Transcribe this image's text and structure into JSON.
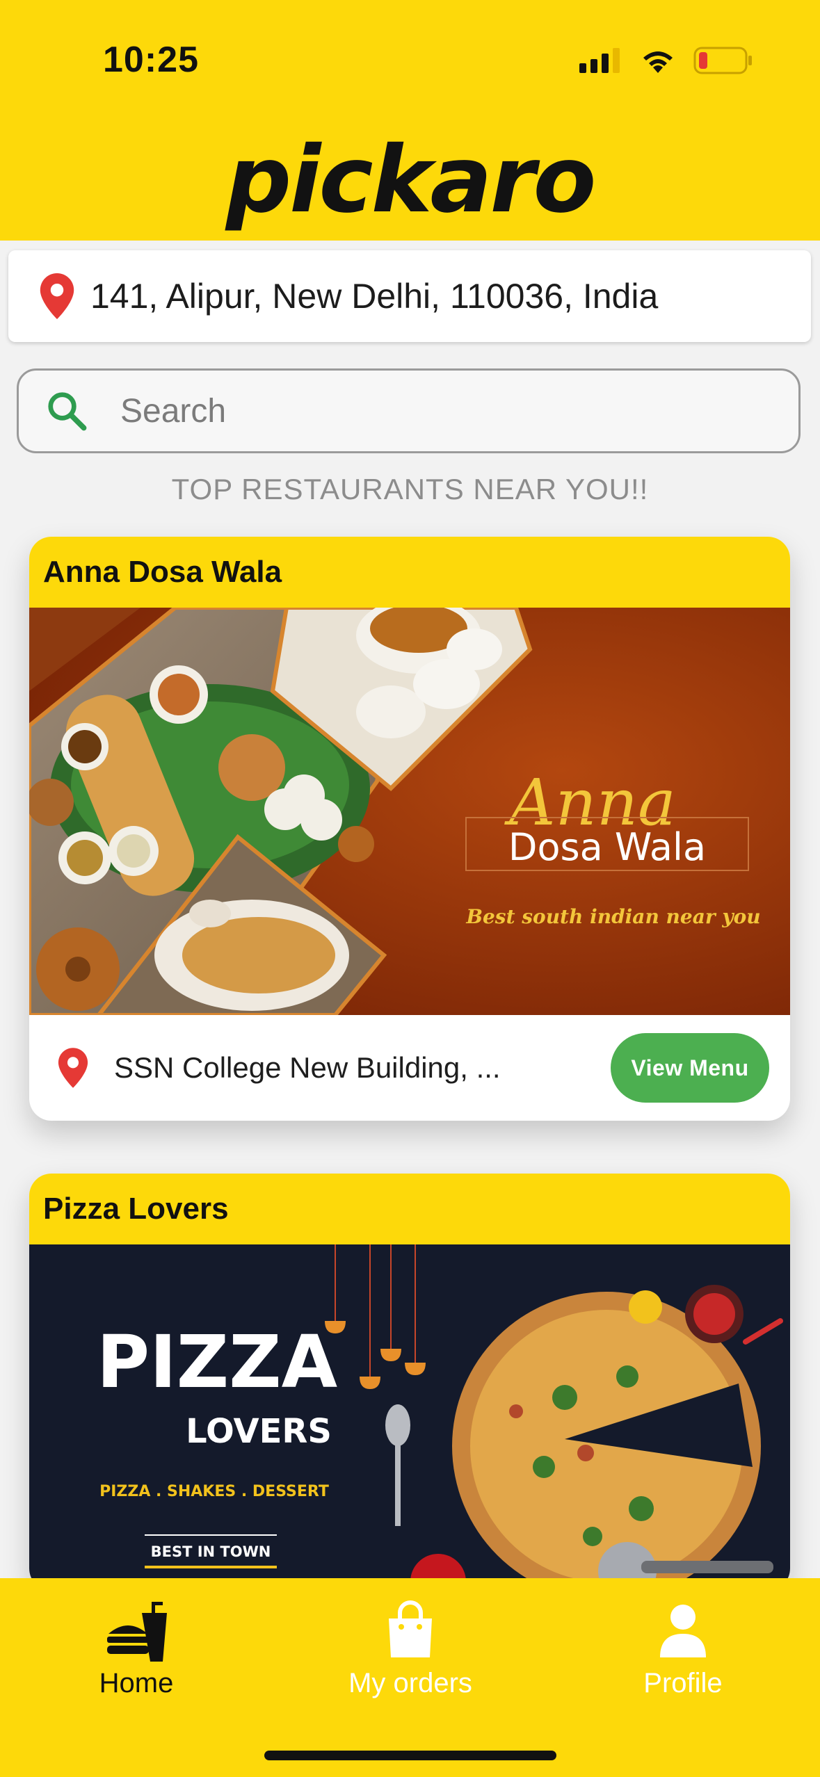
{
  "status_bar": {
    "time": "10:25"
  },
  "app": {
    "logo_text": "pickaro"
  },
  "address_bar": {
    "address": "141, Alipur, New Delhi, 110036, India"
  },
  "search": {
    "placeholder": "Search"
  },
  "section": {
    "title": "TOP RESTAURANTS NEAR YOU!!"
  },
  "restaurants": [
    {
      "name": "Anna Dosa Wala",
      "banner": {
        "title_script": "Anna",
        "title": "Dosa Wala",
        "tagline": "Best south indian near you"
      },
      "address": "SSN College New Building, ...",
      "button_label": "View Menu"
    },
    {
      "name": "Pizza Lovers",
      "banner": {
        "title_big": "PIZZA",
        "title_sub": "LOVERS",
        "tagline": "PIZZA . SHAKES . DESSERT",
        "badge": "BEST IN TOWN"
      }
    }
  ],
  "bottom_nav": {
    "items": [
      {
        "label": "Home",
        "icon": "fastfood-icon",
        "active": true
      },
      {
        "label": "My orders",
        "icon": "shopping-bag-icon",
        "active": false
      },
      {
        "label": "Profile",
        "icon": "person-icon",
        "active": false
      }
    ]
  },
  "colors": {
    "brand_yellow": "#fdd90a",
    "accent_green": "#4caf50",
    "pin_red": "#e53935"
  }
}
